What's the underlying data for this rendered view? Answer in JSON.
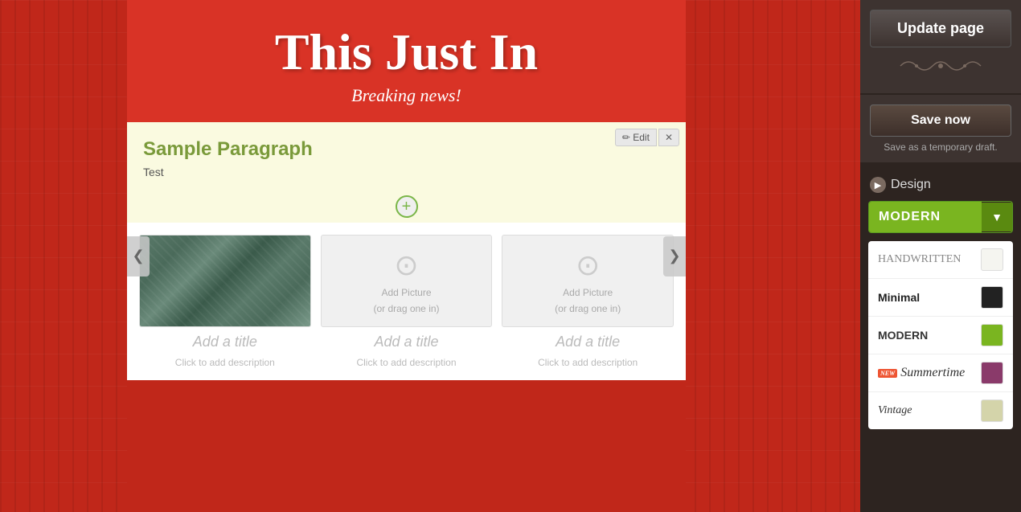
{
  "background": {
    "color": "#c0271a"
  },
  "header": {
    "title": "This Just In",
    "subtitle": "Breaking news!"
  },
  "content_block": {
    "edit_btn": "✏ Edit",
    "close_btn": "✕",
    "paragraph": {
      "title": "Sample Paragraph",
      "text": "Test"
    },
    "add_btn": "+",
    "gallery": {
      "items": [
        {
          "has_image": true,
          "title": "Add a title",
          "description": "Click to add description"
        },
        {
          "has_image": false,
          "placeholder_line1": "Add Picture",
          "placeholder_line2": "(or drag one in)",
          "title": "Add a title",
          "description": "Click to add description"
        },
        {
          "has_image": false,
          "placeholder_line1": "Add Picture",
          "placeholder_line2": "(or drag one in)",
          "title": "Add a title",
          "description": "Click to add description"
        }
      ]
    }
  },
  "nav": {
    "left_arrow": "❮",
    "right_arrow": "❯"
  },
  "right_panel": {
    "update_page_btn": "Update page",
    "ornament": "❧❧❧",
    "save_now_btn": "Save now",
    "save_draft_text": "Save as a temporary draft.",
    "design": {
      "header_label": "Design",
      "current_theme": "MODERN",
      "themes": [
        {
          "name": "HANDWRITTEN",
          "style": "handwritten",
          "swatch": "#f5f5f0"
        },
        {
          "name": "Minimal",
          "style": "minimal",
          "swatch": "#222222"
        },
        {
          "name": "MODERN",
          "style": "modern",
          "swatch": "#7ab520"
        },
        {
          "name": "Summertime",
          "style": "summertime",
          "swatch": "#8a3a6a",
          "is_new": true
        },
        {
          "name": "Vintage",
          "style": "vintage",
          "swatch": "#d4d4aa"
        }
      ]
    }
  }
}
